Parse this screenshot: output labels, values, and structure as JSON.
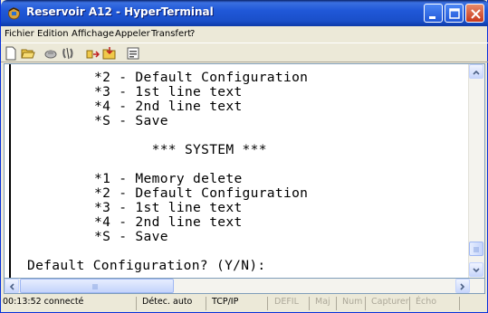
{
  "window": {
    "title": "Reservoir A12 - HyperTerminal"
  },
  "menubar": [
    "Fichier",
    "Edition",
    "Affichage",
    "Appeler",
    "Transfert",
    "?"
  ],
  "toolbar": [
    "new-icon",
    "open-icon",
    "call-icon",
    "disconnect-icon",
    "send-icon",
    "receive-icon",
    "properties-icon"
  ],
  "terminal": {
    "lines": [
      "*2 - Default Configuration",
      "*3 - 1st line text",
      "*4 - 2nd line text",
      "*S - Save",
      "",
      "       *** SYSTEM ***",
      "",
      "*1 - Memory delete",
      "*2 - Default Configuration",
      "*3 - 1st line text",
      "*4 - 2nd line text",
      "*S - Save"
    ],
    "prompt": "Default Configuration? (Y/N):"
  },
  "statusbar": {
    "time": "00:13:52 connecté",
    "detect": "Détec. auto",
    "protocol": "TCP/IP",
    "defil": "DEFIL",
    "maj": "Maj",
    "num": "Num",
    "capture": "Capturer",
    "echo": "Écho"
  }
}
